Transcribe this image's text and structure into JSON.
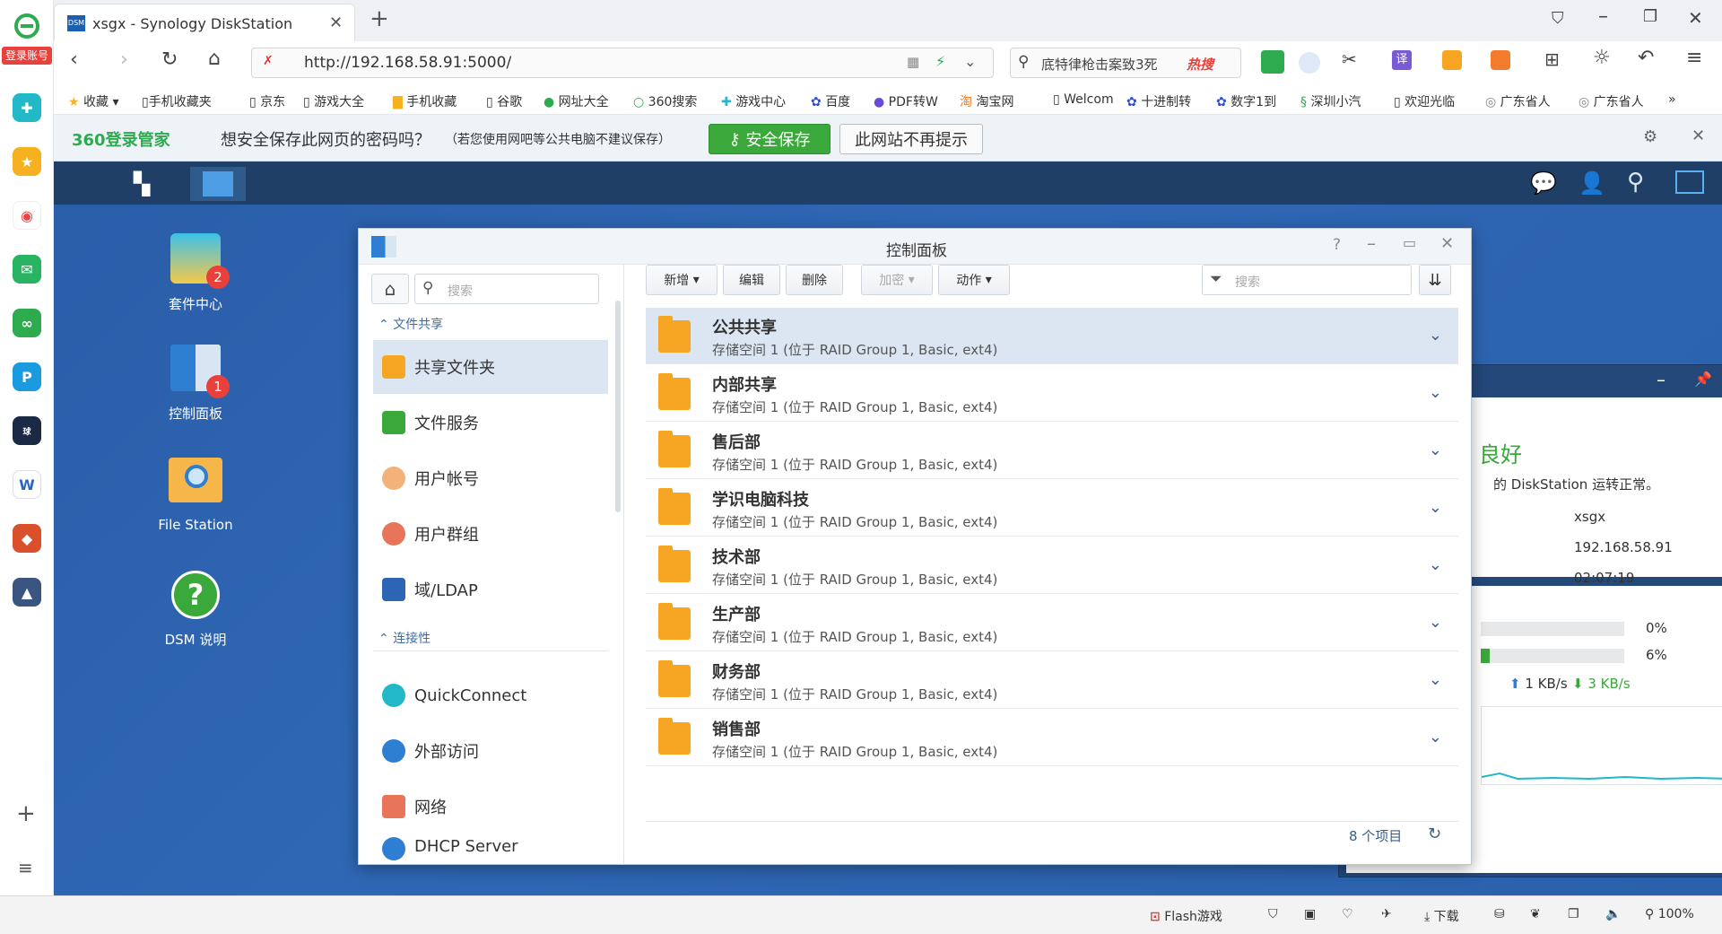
{
  "browser": {
    "side_badge": "登录账号",
    "tab_title": "xsgx - Synology DiskStation",
    "url": "http://192.168.58.91:5000/",
    "search_text": "底特律枪击案致3死",
    "search_hot": "热搜",
    "bookmarks": [
      "收藏",
      "手机收藏夹",
      "京东",
      "游戏大全",
      "手机收藏",
      "谷歌",
      "网址大全",
      "360搜索",
      "游戏中心",
      "百度",
      "PDF转W",
      "淘宝网",
      "Welcom",
      "十进制转",
      "数字1到",
      "深圳小汽",
      "欢迎光临",
      "广东省人",
      "广东省人"
    ],
    "bookmarks_more": "»"
  },
  "password_bar": {
    "logo": "360登录管家",
    "question": "想安全保存此网页的密码吗？",
    "note": "（若您使用网吧等公共电脑不建议保存）",
    "save_button": "安全保存",
    "never_button": "此网站不再提示"
  },
  "desktop": {
    "icons": [
      {
        "label": "套件中心",
        "badge": "2"
      },
      {
        "label": "控制面板",
        "badge": "1"
      },
      {
        "label": "File Station",
        "badge": ""
      },
      {
        "label": "DSM 说明",
        "badge": ""
      }
    ]
  },
  "control_panel": {
    "title": "控制面板",
    "left_search_placeholder": "搜索",
    "sections": [
      {
        "title": "文件共享",
        "items": [
          "共享文件夹",
          "文件服务",
          "用户帐号",
          "用户群组",
          "域/LDAP"
        ]
      },
      {
        "title": "连接性",
        "items": [
          "QuickConnect",
          "外部访问",
          "网络",
          "DHCP Server"
        ]
      }
    ],
    "toolbar": {
      "new": "新增",
      "edit": "编辑",
      "delete": "删除",
      "encrypt": "加密",
      "action": "动作",
      "search_placeholder": "搜索"
    },
    "folders": [
      {
        "name": "公共共享",
        "desc": "存储空间 1 (位于 RAID Group 1, Basic, ext4)"
      },
      {
        "name": "内部共享",
        "desc": "存储空间 1 (位于 RAID Group 1, Basic, ext4)"
      },
      {
        "name": "售后部",
        "desc": "存储空间 1 (位于 RAID Group 1, Basic, ext4)"
      },
      {
        "name": "学识电脑科技",
        "desc": "存储空间 1 (位于 RAID Group 1, Basic, ext4)"
      },
      {
        "name": "技术部",
        "desc": "存储空间 1 (位于 RAID Group 1, Basic, ext4)"
      },
      {
        "name": "生产部",
        "desc": "存储空间 1 (位于 RAID Group 1, Basic, ext4)"
      },
      {
        "name": "财务部",
        "desc": "存储空间 1 (位于 RAID Group 1, Basic, ext4)"
      },
      {
        "name": "销售部",
        "desc": "存储空间 1 (位于 RAID Group 1, Basic, ext4)"
      }
    ],
    "item_count": "8 个项目"
  },
  "widget": {
    "health_word": "良好",
    "health_text": "的 DiskStation 运转正常。",
    "server_name": "xsgx",
    "ip": "192.168.58.91",
    "uptime": "02:07:19",
    "cpu_percent": "0%",
    "ram_percent": "6%",
    "cpu_fraction": 0.0,
    "ram_fraction": 0.06,
    "upload": "1 KB/s",
    "download": "3 KB/s"
  },
  "statusbar": {
    "flash": "Flash游戏",
    "download": "下载",
    "zoom": "100%"
  },
  "colors": {
    "desktop_bg": "#2b61ac",
    "folder": "#f6a623",
    "save_green": "#3aa83a",
    "accent": "#3c6ea6"
  }
}
